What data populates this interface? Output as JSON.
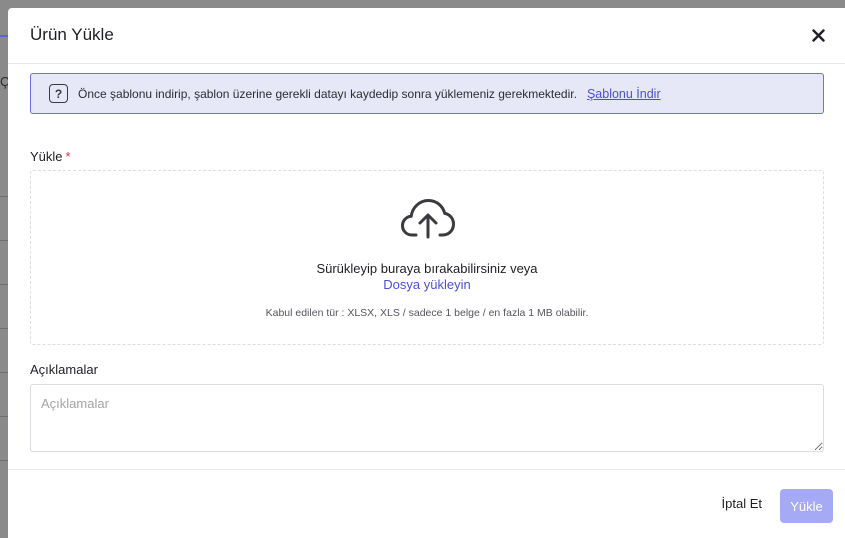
{
  "background": {
    "partial_glyph": "Ç"
  },
  "modal": {
    "title": "Ürün Yükle",
    "info": {
      "text": "Önce şablonu indirip, şablon üzerine gerekli datayı kaydedip sonra yüklemeniz gerekmektedir.",
      "link": "Şablonu İndir",
      "icon": "question-icon"
    },
    "upload": {
      "label": "Yükle",
      "required_mark": "*",
      "drop_text": "Sürükleyip buraya bırakabilirsiniz veya",
      "browse_link": "Dosya yükleyin",
      "hint": "Kabul edilen tür : XLSX, XLS / sadece 1 belge / en fazla 1 MB olabilir.",
      "icon": "cloud-upload-icon"
    },
    "notes": {
      "label": "Açıklamalar",
      "placeholder": "Açıklamalar",
      "value": ""
    },
    "footer": {
      "cancel_label": "İptal Et",
      "submit_label": "Yükle"
    }
  },
  "colors": {
    "accent": "#4b50d6",
    "info_bg": "#e6e8f8",
    "info_border": "#6c72e6",
    "submit_disabled": "#a6a9f4",
    "required": "#e0303a",
    "overlay": "#8a8a8a"
  }
}
